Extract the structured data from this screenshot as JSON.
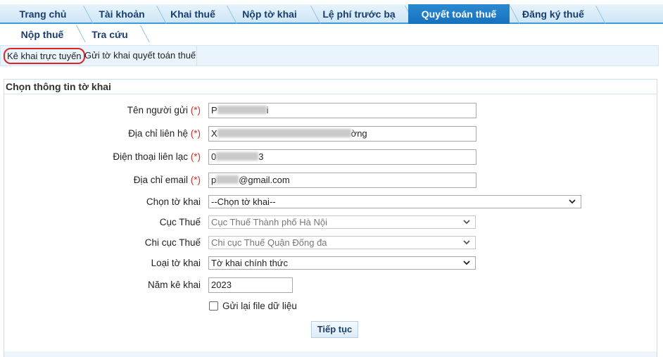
{
  "top_nav": {
    "tabs": [
      {
        "label": "Trang chủ"
      },
      {
        "label": "Tài khoản"
      },
      {
        "label": "Khai thuế"
      },
      {
        "label": "Nộp tờ khai"
      },
      {
        "label": "Lệ phí trước bạ"
      },
      {
        "label": "Quyết toán thuế"
      },
      {
        "label": "Đăng ký thuế"
      }
    ],
    "active_index": 5
  },
  "sub_nav": {
    "tabs": [
      {
        "label": "Nộp thuế"
      },
      {
        "label": "Tra cứu"
      }
    ]
  },
  "function_bar": {
    "items": [
      {
        "label": "Kê khai trực tuyến"
      },
      {
        "label": "Gửi tờ khai quyết toán thuế"
      }
    ]
  },
  "panel": {
    "title": "Chọn thông tin tờ khai",
    "required_mark": "(*)",
    "fields": {
      "sender_name": {
        "label": "Tên người gửi",
        "value_prefix": "P",
        "value_suffix": "i"
      },
      "address": {
        "label": "Địa chỉ liên hệ",
        "value_prefix": "X",
        "value_suffix": "ờng"
      },
      "phone": {
        "label": "Điện thoại liên lạc",
        "value_prefix": "0",
        "value_suffix": "3"
      },
      "email": {
        "label": "Địa chỉ email",
        "value_prefix": "p",
        "value_suffix": "@gmail.com"
      },
      "declaration": {
        "label": "Chọn tờ khai",
        "value": "--Chọn tờ khai--"
      },
      "tax_department": {
        "label": "Cục Thuế",
        "value": "Cục Thuế Thành phố Hà Nội"
      },
      "tax_branch": {
        "label": "Chi cục Thuế",
        "value": "Chi cục Thuế Quận Đống đa"
      },
      "declaration_type": {
        "label": "Loại tờ khai",
        "value": "Tờ khai chính thức"
      },
      "year": {
        "label": "Năm kê khai",
        "value": "2023"
      },
      "resend_file": {
        "label": "Gửi lại file dữ liệu",
        "checked": false
      }
    },
    "continue_label": "Tiếp tục"
  }
}
